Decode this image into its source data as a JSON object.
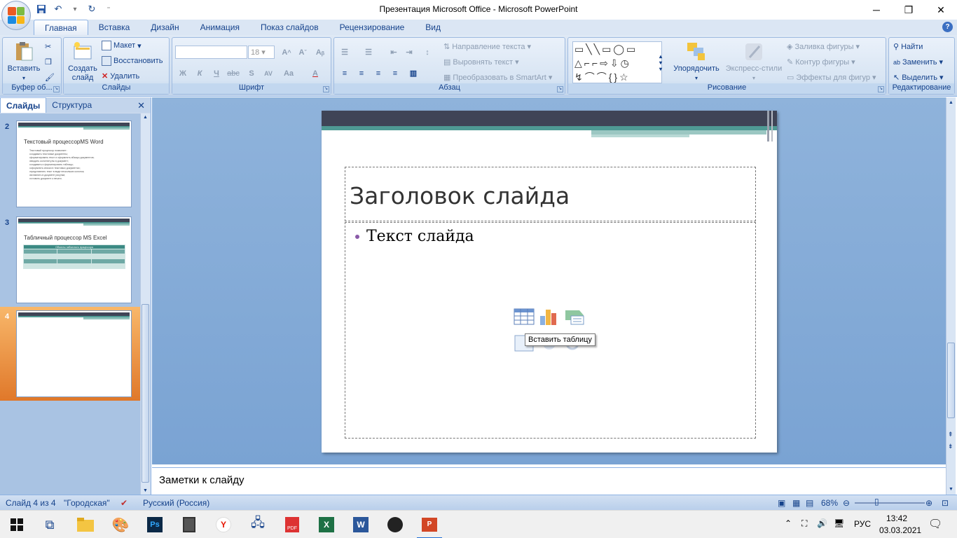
{
  "window": {
    "title": "Презентация Microsoft Office - Microsoft PowerPoint"
  },
  "ribbon": {
    "tabs": [
      "Главная",
      "Вставка",
      "Дизайн",
      "Анимация",
      "Показ слайдов",
      "Рецензирование",
      "Вид"
    ],
    "active_tab": "Главная",
    "clipboard": {
      "paste": "Вставить",
      "label": "Буфер об..."
    },
    "slides": {
      "new_slide_line1": "Создать",
      "new_slide_line2": "слайд",
      "layout": "Макет",
      "reset": "Восстановить",
      "delete": "Удалить",
      "label": "Слайды"
    },
    "font": {
      "size": "18",
      "label": "Шрифт"
    },
    "paragraph": {
      "text_direction": "Направление текста",
      "align_text": "Выровнять текст",
      "smartart": "Преобразовать в SmartArt",
      "label": "Абзац"
    },
    "drawing": {
      "arrange": "Упорядочить",
      "quick_styles": "Экспресс-стили",
      "shape_fill": "Заливка фигуры",
      "shape_outline": "Контур фигуры",
      "shape_effects": "Эффекты для фигур",
      "label": "Рисование"
    },
    "editing": {
      "find": "Найти",
      "replace": "Заменить",
      "select": "Выделить",
      "label": "Редактирование"
    }
  },
  "left_pane": {
    "tabs": [
      "Слайды",
      "Структура"
    ],
    "thumbnails": [
      {
        "number": "2",
        "title": "Текстовый процессорMS Word",
        "lines": [
          "Текстовый процессор позволяет:",
          "•создавать текстовые документы;",
          "•форматировать текст и оформлять абзацы документов;",
          "•вводить колонтитулы в документ;",
          "•создавать и форматировать таблицы;",
          "•оформлять списки в текстовых документах;",
          "•представлять текст в виде нескольких колонок;",
          "•вставлять в документ рисунки;",
          "•готовить документ к печати."
        ]
      },
      {
        "number": "3",
        "title": "Табличный процессор MS Excel",
        "table_header": "Объекты табличного процессора"
      },
      {
        "number": "4",
        "title": ""
      }
    ]
  },
  "slide": {
    "title": "Заголовок слайда",
    "bullet": "Текст слайда",
    "tooltip": "Вставить таблицу"
  },
  "notes": {
    "placeholder": "Заметки к слайду"
  },
  "status": {
    "slide_counter": "Слайд 4 из 4",
    "theme": "\"Городская\"",
    "language": "Русский (Россия)",
    "zoom": "68%"
  },
  "taskbar": {
    "lang": "РУС",
    "time": "13:42",
    "date": "03.03.2021"
  },
  "colors": {
    "accent_blue": "#15428b",
    "slide_dark": "#3f4456",
    "slide_teal": "#4f9a94",
    "selected_thumb": "#e0782a"
  }
}
